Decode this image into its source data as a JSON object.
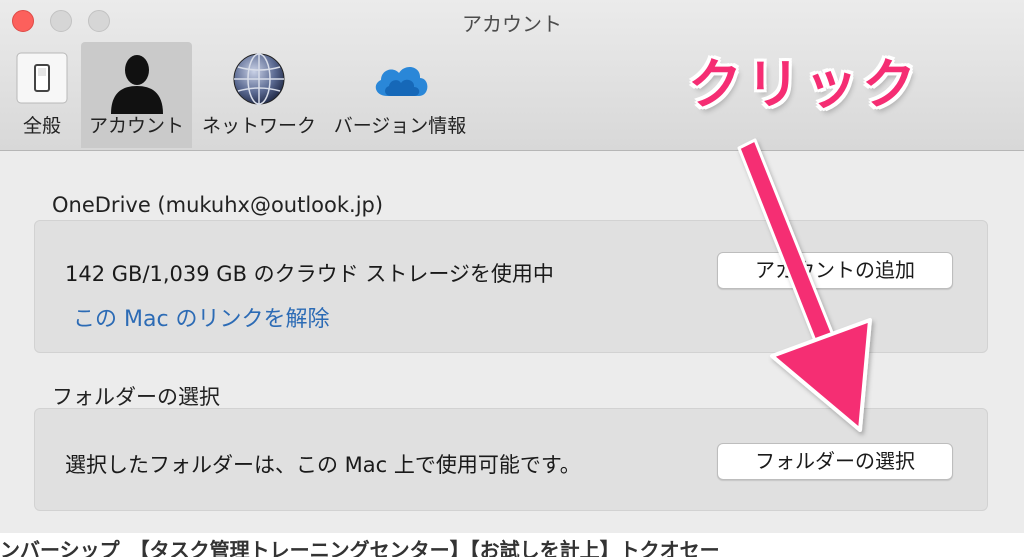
{
  "window": {
    "title": "アカウント"
  },
  "toolbar": {
    "items": [
      {
        "label": "全般",
        "icon": "switch-icon"
      },
      {
        "label": "アカウント",
        "icon": "user-silhouette-icon",
        "active": true
      },
      {
        "label": "ネットワーク",
        "icon": "globe-icon"
      },
      {
        "label": "バージョン情報",
        "icon": "onedrive-cloud-icon"
      }
    ]
  },
  "account": {
    "header": "OneDrive (mukuhx@outlook.jp)",
    "storage_text": "142 GB/1,039 GB のクラウド ストレージを使用中",
    "unlink_link": "この Mac のリンクを解除",
    "add_account_button": "アカウントの追加"
  },
  "folders": {
    "header": "フォルダーの選択",
    "description": "選択したフォルダーは、この Mac 上で使用可能です。",
    "choose_button": "フォルダーの選択"
  },
  "annotation": {
    "text": "クリック",
    "color": "#f52d73"
  },
  "background_page": {
    "text": "ンバーシップ　【タスク管理トレーニングセンター】【お試しを計上】トクオセー"
  },
  "colors": {
    "link": "#2c6bb5",
    "close_button": "#fc605c",
    "accent_pink": "#f52d73"
  }
}
